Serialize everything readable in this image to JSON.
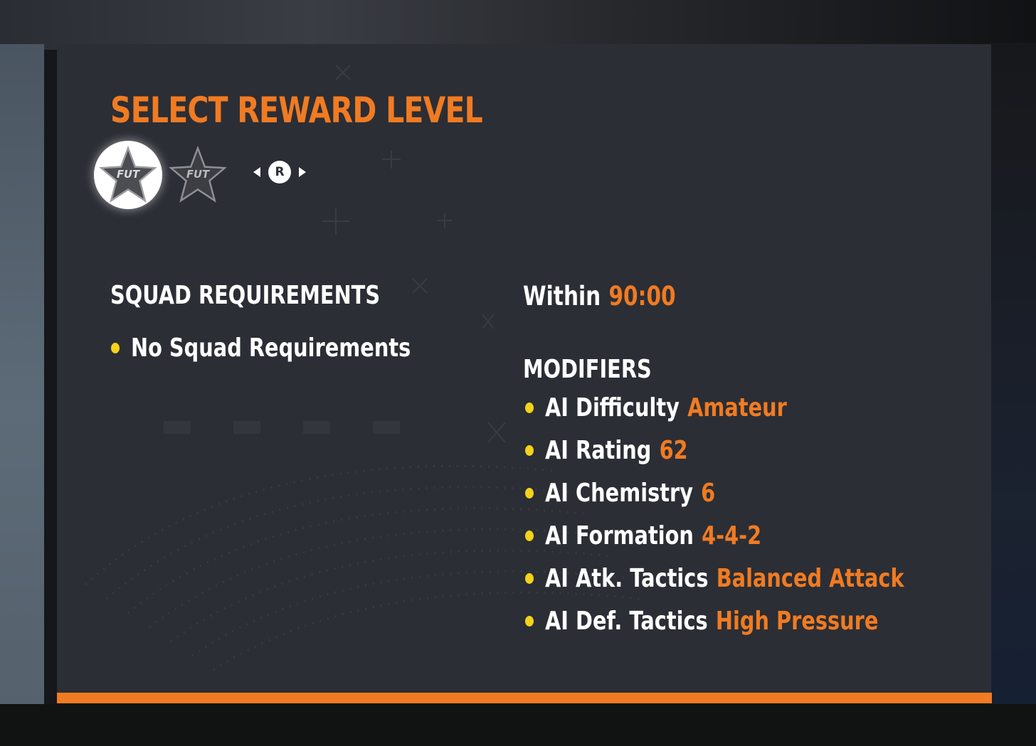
{
  "title": "SELECT REWARD LEVEL",
  "reward_levels": [
    {
      "badge_text": "FUT",
      "selected": true
    },
    {
      "badge_text": "FUT",
      "selected": false
    }
  ],
  "controller_hint": {
    "button": "R"
  },
  "squad_requirements": {
    "heading": "SQUAD REQUIREMENTS",
    "items": [
      "No Squad Requirements"
    ]
  },
  "time_limit": {
    "label": "Within",
    "value": "90:00"
  },
  "modifiers": {
    "heading": "MODIFIERS",
    "items": [
      {
        "label": "AI Difficulty",
        "value": "Amateur"
      },
      {
        "label": "AI Rating",
        "value": "62"
      },
      {
        "label": "AI Chemistry",
        "value": "6"
      },
      {
        "label": "AI Formation",
        "value": "4-4-2"
      },
      {
        "label": "AI Atk. Tactics",
        "value": "Balanced Attack"
      },
      {
        "label": "AI Def. Tactics",
        "value": "High Pressure"
      }
    ]
  },
  "colors": {
    "accent": "#f07b22",
    "bullet": "#f5d21a",
    "panel": "#2b2e35",
    "text": "#ffffff"
  }
}
